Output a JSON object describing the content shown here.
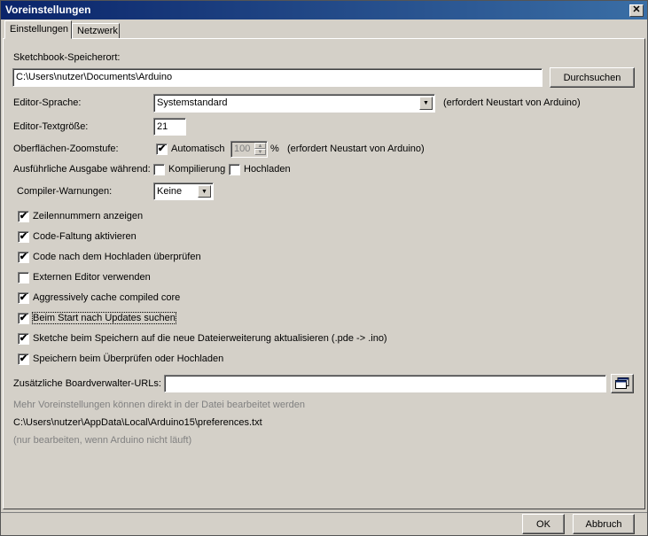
{
  "window": {
    "title": "Voreinstellungen",
    "close_glyph": "✕"
  },
  "tabs": [
    {
      "label": "Einstellungen"
    },
    {
      "label": "Netzwerk"
    }
  ],
  "settings": {
    "sketchbook_label": "Sketchbook-Speicherort:",
    "sketchbook_path": "C:\\Users\\nutzer\\Documents\\Arduino",
    "browse_button": "Durchsuchen",
    "editor_language_label": "Editor-Sprache:",
    "editor_language_value": "Systemstandard",
    "restart_note_1": "(erfordert Neustart von Arduino)",
    "font_size_label": "Editor-Textgröße:",
    "font_size_value": "21",
    "zoom_label": "Oberflächen-Zoomstufe:",
    "zoom_auto_label": "Automatisch",
    "zoom_auto_checked": true,
    "zoom_value": "100",
    "zoom_unit": "%",
    "restart_note_2": "(erfordert Neustart von Arduino)",
    "verbose_label": "Ausführliche Ausgabe während:",
    "verbose_compile_label": "Kompilierung",
    "verbose_compile_checked": false,
    "verbose_upload_label": "Hochladen",
    "verbose_upload_checked": false,
    "warnings_label": "Compiler-Warnungen:",
    "warnings_value": "Keine",
    "options": [
      {
        "label": "Zeilennummern anzeigen",
        "checked": true
      },
      {
        "label": "Code-Faltung aktivieren",
        "checked": true
      },
      {
        "label": "Code nach dem Hochladen überprüfen",
        "checked": true
      },
      {
        "label": "Externen Editor verwenden",
        "checked": false
      },
      {
        "label": "Aggressively cache compiled core",
        "checked": true
      },
      {
        "label": "Beim Start nach Updates suchen",
        "checked": true
      },
      {
        "label": "Sketche beim Speichern auf die neue Dateierweiterung aktualisieren (.pde -> .ino)",
        "checked": true
      },
      {
        "label": "Speichern beim Überprüfen oder Hochladen",
        "checked": true
      }
    ],
    "board_urls_label": "Zusätzliche Boardverwalter-URLs:",
    "board_urls_value": "",
    "more_prefs_note": "Mehr Voreinstellungen können direkt in der Datei bearbeitet werden",
    "prefs_path": "C:\\Users\\nutzer\\AppData\\Local\\Arduino15\\preferences.txt",
    "edit_note": "(nur bearbeiten, wenn Arduino nicht läuft)"
  },
  "footer": {
    "ok_label": "OK",
    "cancel_label": "Abbruch"
  },
  "icons": {
    "check": "✔",
    "arrow_down": "▼",
    "spin_up": "▲",
    "spin_down": "▼"
  }
}
